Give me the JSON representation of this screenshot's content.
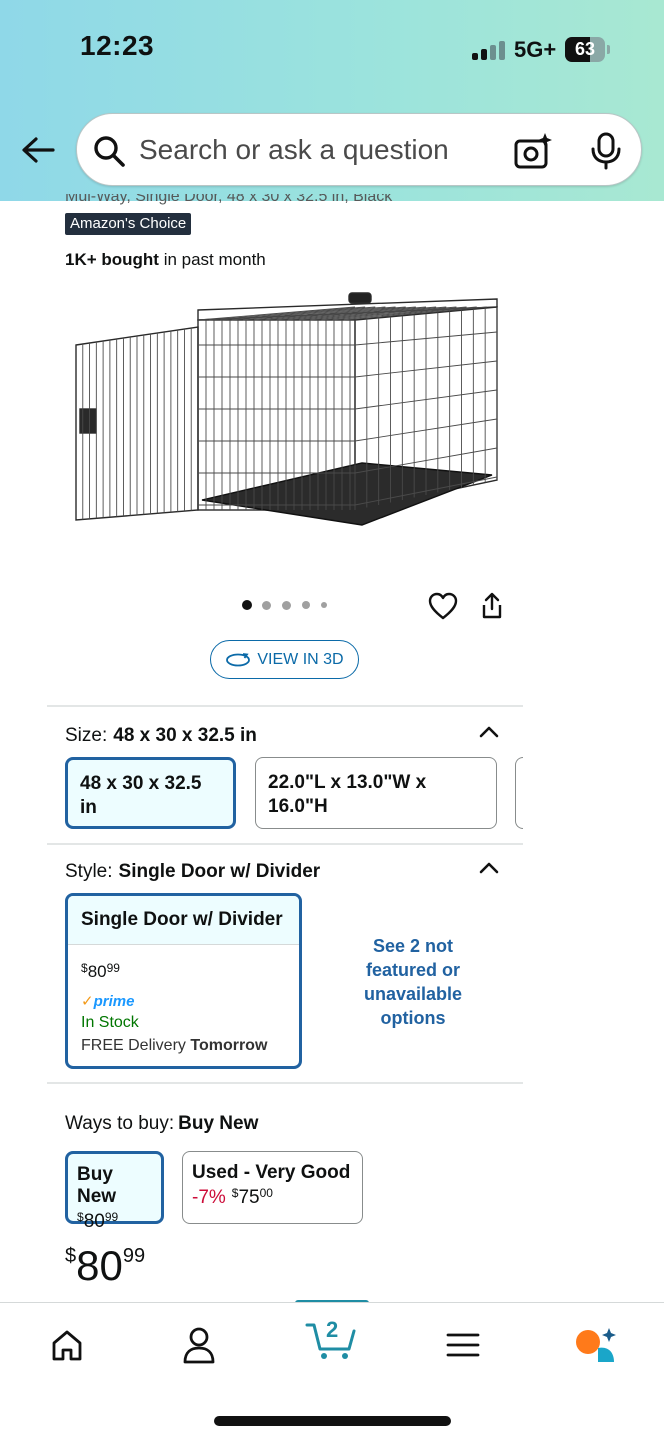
{
  "status_bar": {
    "time": "12:23",
    "network": "5G+",
    "battery": "63"
  },
  "search": {
    "placeholder": "Search or ask a question"
  },
  "product": {
    "clipped_title": "Mul-Way, Single Door, 48 x 30 x 32.5 in, Black",
    "badge": "Amazon's Choice",
    "bought_bold": "1K+ bought",
    "bought_rest": " in past month",
    "view_3d_label": "VIEW IN 3D",
    "image_count": 5,
    "image_active_index": 0
  },
  "size": {
    "label": "Size:",
    "value": "48 x 30 x 32.5 in",
    "options": [
      "48 x 30 x 32.5 in",
      "22.0\"L x 13.0\"W x 16.0\"H"
    ]
  },
  "style": {
    "label": "Style:",
    "value": "Single Door w/ Divider",
    "card": {
      "title": "Single Door w/ Divider",
      "price_currency": "$",
      "price_whole": "80",
      "price_fraction": "99",
      "prime": "prime",
      "stock": "In Stock",
      "delivery_prefix": "FREE Delivery ",
      "delivery_day": "Tomorrow"
    },
    "see_more": "See 2 not featured or unavailable options"
  },
  "ways_to_buy": {
    "label": "Ways to buy:",
    "value": "Buy New",
    "options": [
      {
        "title": "Buy New",
        "currency": "$",
        "whole": "80",
        "fraction": "99",
        "discount": ""
      },
      {
        "title": "Used - Very Good",
        "currency": "$",
        "whole": "75",
        "fraction": "00",
        "discount": "-7%"
      }
    ]
  },
  "price": {
    "currency": "$",
    "whole": "80",
    "fraction": "99"
  },
  "bottom_nav": {
    "cart_count": "2",
    "items": [
      "home-icon",
      "account-icon",
      "cart-icon",
      "menu-icon",
      "rufus-icon"
    ]
  },
  "colors": {
    "accent_blue": "#2162a1",
    "selected_bg": "#edfdff",
    "in_stock": "#007600",
    "discount": "#cc0c39",
    "cart_teal": "#1f8da4",
    "rufus_orange": "#ff7a1a"
  }
}
